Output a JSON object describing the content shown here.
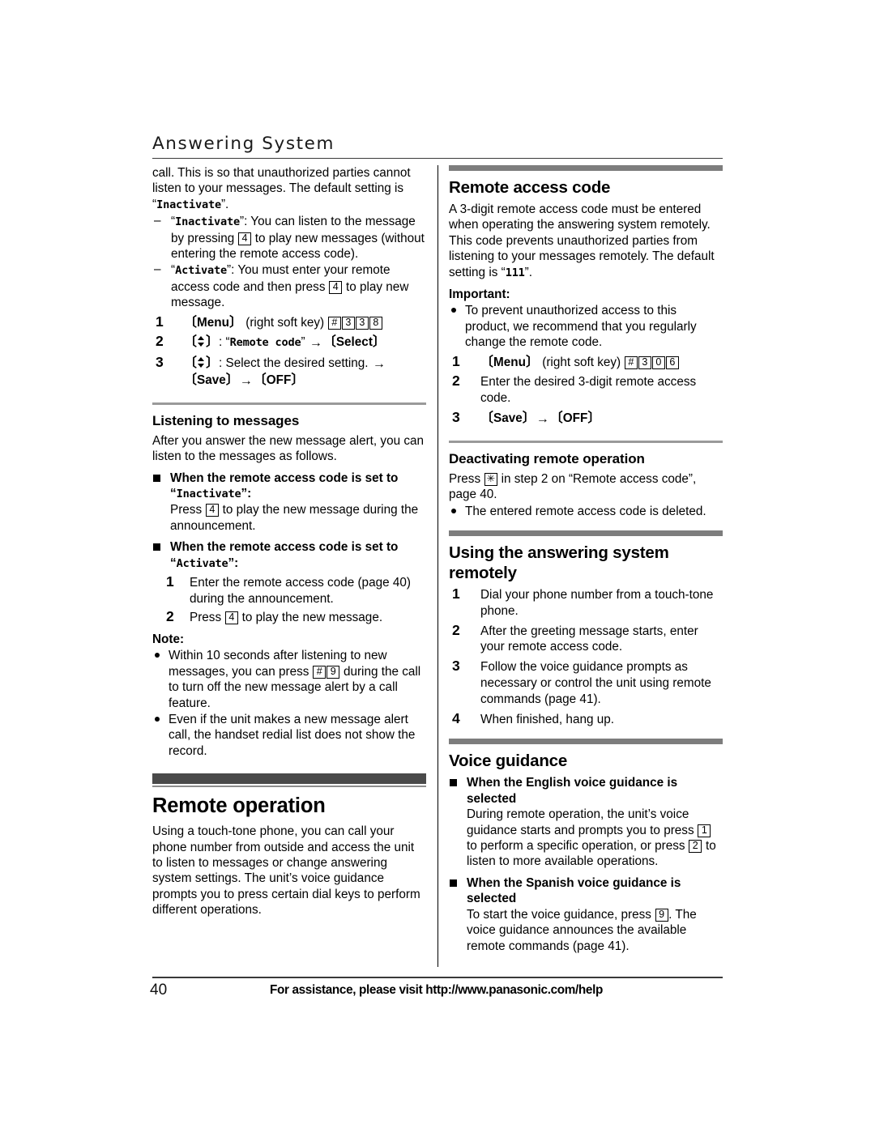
{
  "header": {
    "running_title": "Answering System"
  },
  "left_column": {
    "intro_paragraph": {
      "text_a": "call. This is so that unauthorized parties cannot listen to your messages. The default setting is “",
      "mono_a": "Inactivate",
      "text_b": "”."
    },
    "dash_items": [
      {
        "mono": "Inactivate",
        "lead_quote": "“",
        "close_quote": "”",
        "text_a": ": You can listen to the message by pressing ",
        "key": "4",
        "text_b": " to play new messages (without entering the remote access code)."
      },
      {
        "mono": "Activate",
        "lead_quote": "“",
        "close_quote": "”",
        "text_a": ": You must enter your remote access code and then press ",
        "key": "4",
        "text_b": " to play new message."
      }
    ],
    "steps": [
      {
        "num": "1",
        "soft_key": "Menu",
        "text_a": " (right soft key) ",
        "keys": [
          "#",
          "3",
          "3",
          "8"
        ]
      },
      {
        "num": "2",
        "text_a": ": “",
        "mono": "Remote code",
        "text_b": "” ",
        "arrow": "→",
        "soft_key": "Select"
      },
      {
        "num": "3",
        "text_a": ": Select the desired setting. ",
        "arrow": "→",
        "soft_key_a": "Save",
        "arrow_2": "→",
        "soft_key_b": "OFF"
      }
    ],
    "listening": {
      "heading": "Listening to messages",
      "intro": "After you answer the new message alert, you can listen to the messages as follows.",
      "blocks": [
        {
          "head_text": "When the remote access code is set to ",
          "head_mono_quote_open": "“",
          "head_mono": "Inactivate",
          "head_mono_quote_close": "”:",
          "body_a": "Press ",
          "body_key": "4",
          "body_b": " to play the new message during the announcement."
        },
        {
          "head_text": "When the remote access code is set to ",
          "head_mono_quote_open": "“",
          "head_mono": "Activate",
          "head_mono_quote_close": "”:",
          "substeps": [
            {
              "num": "1",
              "text": "Enter the remote access code (page 40) during the announcement."
            },
            {
              "num": "2",
              "text_a": "Press ",
              "key": "4",
              "text_b": " to play the new message."
            }
          ]
        }
      ]
    },
    "note": {
      "label": "Note:",
      "bullets": [
        {
          "text_a": "Within 10 seconds after listening to new messages, you can press ",
          "keys": [
            "#",
            "9"
          ],
          "text_b": " during the call to turn off the new message alert by a call feature."
        },
        {
          "text_a": "Even if the unit makes a new message alert call, the handset redial list does not show the record.",
          "keys": [],
          "text_b": ""
        }
      ]
    },
    "remote_operation": {
      "heading": "Remote operation",
      "paragraph": "Using a touch-tone phone, you can call your phone number from outside and access the unit to listen to messages or change answering system settings. The unit’s voice guidance prompts you to press certain dial keys to perform different operations."
    }
  },
  "right_column": {
    "remote_access_code": {
      "heading": "Remote access code",
      "paragraph_a": "A 3-digit remote access code must be entered when operating the answering system remotely. This code prevents unauthorized parties from listening to your messages remotely. The default setting is “",
      "paragraph_mono": "111",
      "paragraph_b": "”.",
      "important_label": "Important:",
      "important_bullet": "To prevent unauthorized access to this product, we recommend that you regularly change the remote code.",
      "steps": [
        {
          "num": "1",
          "soft_key": "Menu",
          "text_a": " (right soft key) ",
          "keys": [
            "#",
            "3",
            "0",
            "6"
          ]
        },
        {
          "num": "2",
          "text": "Enter the desired 3-digit remote access code."
        },
        {
          "num": "3",
          "soft_key_a": "Save",
          "arrow": "→",
          "soft_key_b": "OFF"
        }
      ]
    },
    "deactivating": {
      "heading": "Deactivating remote operation",
      "text_a": "Press ",
      "key": "✳",
      "text_b": " in step 2 on “Remote access code”, page 40.",
      "bullet": "The entered remote access code is deleted."
    },
    "using_remotely": {
      "heading": "Using the answering system remotely",
      "steps": [
        {
          "num": "1",
          "text": "Dial your phone number from a touch-tone phone."
        },
        {
          "num": "2",
          "text": "After the greeting message starts, enter your remote access code."
        },
        {
          "num": "3",
          "text": "Follow the voice guidance prompts as necessary or control the unit using remote commands (page 41)."
        },
        {
          "num": "4",
          "text": "When finished, hang up."
        }
      ]
    },
    "voice_guidance": {
      "heading": "Voice guidance",
      "blocks": [
        {
          "head": "When the English voice guidance is selected",
          "body_a": "During remote operation, the unit’s voice guidance starts and prompts you to press ",
          "key_1": "1",
          "body_b": " to perform a specific operation, or press ",
          "key_2": "2",
          "body_c": " to listen to more available operations."
        },
        {
          "head": "When the Spanish voice guidance is selected",
          "body_a": "To start the voice guidance, press ",
          "key_1": "9",
          "body_b": ". The voice guidance announces the available remote commands (page 41)."
        }
      ]
    }
  },
  "footer": {
    "page_number": "40",
    "assistance_text": "For assistance, please visit http://www.panasonic.com/help"
  },
  "colors": {
    "major_bar": "#4a4a4a",
    "section_bar": "#7d7d7d",
    "sub_rule": "#9a9a9a",
    "text": "#000000"
  }
}
